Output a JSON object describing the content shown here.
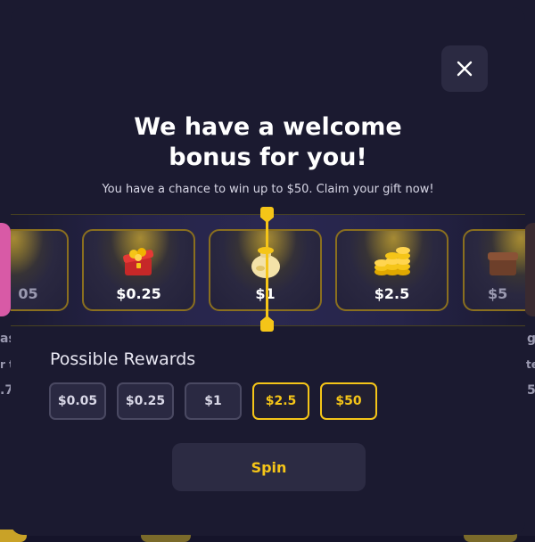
{
  "background": {
    "partial_left_label": "as",
    "partial_left_sub": "r t",
    "partial_left_num": ".7",
    "partial_right_label": "g",
    "partial_right_sub": "te",
    "partial_right_num": "5"
  },
  "modal": {
    "title_line1": "We have a welcome",
    "title_line2": "bonus for you!",
    "subtitle": "You have a chance to win up to $50. Claim your gift now!"
  },
  "reel": {
    "items": [
      {
        "label": "05",
        "icon": "coins-icon"
      },
      {
        "label": "$0.25",
        "icon": "treasure-chest-icon"
      },
      {
        "label": "$1",
        "icon": "coin-sack-icon"
      },
      {
        "label": "$2.5",
        "icon": "coin-stack-icon"
      },
      {
        "label": "$5",
        "icon": "treasure-chest-icon"
      }
    ]
  },
  "rewards": {
    "label": "Possible Rewards",
    "items": [
      {
        "label": "$0.05",
        "highlighted": false
      },
      {
        "label": "$0.25",
        "highlighted": false
      },
      {
        "label": "$1",
        "highlighted": false
      },
      {
        "label": "$2.5",
        "highlighted": true
      },
      {
        "label": "$50",
        "highlighted": true
      }
    ]
  },
  "spin_button": {
    "label": "Spin"
  },
  "colors": {
    "accent": "#f5c518",
    "panel": "#1b1a30",
    "chip": "#2a2942"
  }
}
